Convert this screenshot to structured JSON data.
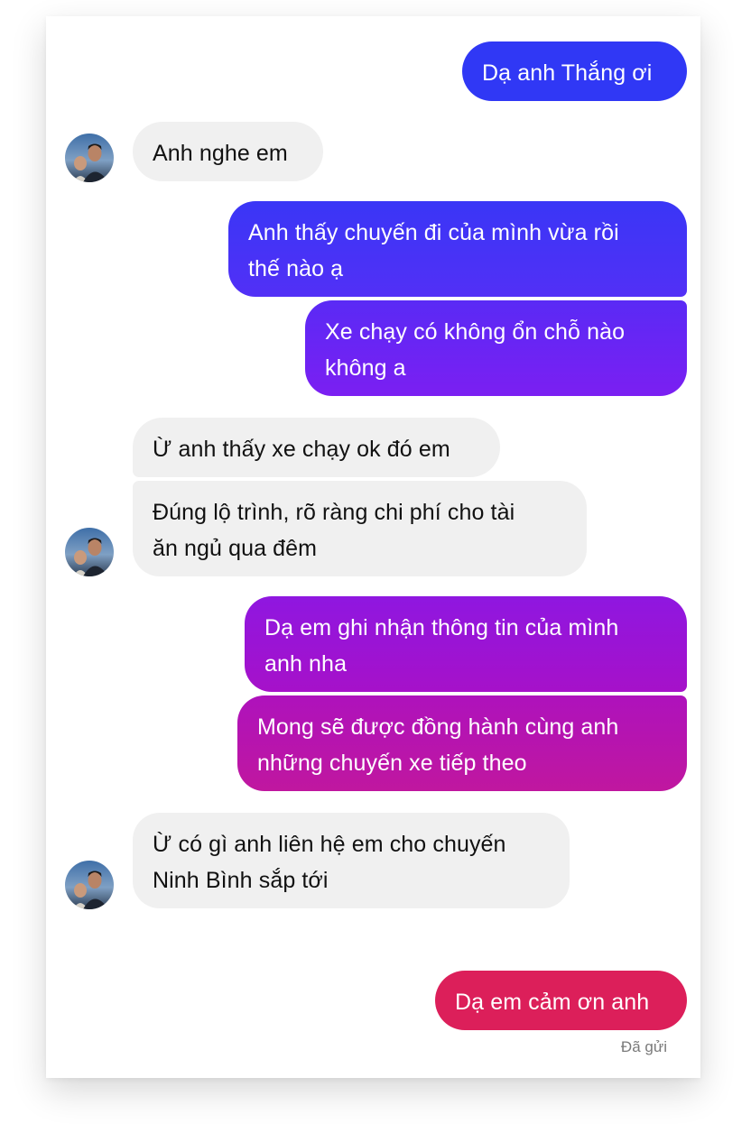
{
  "conversation": {
    "messages": [
      {
        "id": "m1",
        "direction": "outgoing",
        "lines": [
          "Dạ anh Thắng ơi"
        ],
        "color": "#3137f5"
      },
      {
        "id": "m2",
        "direction": "incoming",
        "lines": [
          "Anh nghe em"
        ]
      },
      {
        "id": "m3",
        "direction": "outgoing",
        "lines": [
          "Anh thấy chuyến đi của mình vừa rồi",
          "thế nào ạ"
        ],
        "color": "#4a32f6"
      },
      {
        "id": "m4",
        "direction": "outgoing",
        "lines": [
          "Xe chạy có không ổn chỗ nào",
          "không a"
        ],
        "color": "#6a22f2"
      },
      {
        "id": "m5",
        "direction": "incoming",
        "lines": [
          "Ừ anh thấy xe chạy ok đó em"
        ]
      },
      {
        "id": "m6",
        "direction": "incoming",
        "lines": [
          "Đúng lộ trình, rõ ràng chi phí cho tài",
          "ăn ngủ qua đêm"
        ]
      },
      {
        "id": "m7",
        "direction": "outgoing",
        "lines": [
          "Dạ em ghi nhận thông tin của mình",
          "anh nha"
        ],
        "color": "#9d12d3"
      },
      {
        "id": "m8",
        "direction": "outgoing",
        "lines": [
          "Mong sẽ được đồng hành cùng anh",
          "những chuyến xe tiếp theo"
        ],
        "color": "#b514ad"
      },
      {
        "id": "m9",
        "direction": "incoming",
        "lines": [
          "Ừ có gì anh liên hệ em cho chuyến",
          "Ninh Bình sắp tới"
        ]
      },
      {
        "id": "m10",
        "direction": "outgoing",
        "lines": [
          "Dạ em cảm ơn anh"
        ],
        "color": "#dc1f5c"
      }
    ],
    "status": "Đã gửi"
  },
  "colors": {
    "incoming_bubble": "#f0f0f0",
    "outgoing_gradient": [
      "#2f3cf5",
      "#6c22f3",
      "#a50fd0",
      "#c8169a",
      "#e0205a"
    ]
  },
  "icons": {
    "contact_avatar": "avatar-photo"
  }
}
